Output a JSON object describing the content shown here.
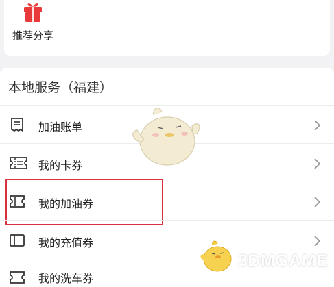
{
  "share": {
    "label": "推荐分享",
    "icon": "gift-icon",
    "icon_color": "#e83a3a"
  },
  "section": {
    "title": "本地服务（福建）"
  },
  "rows": [
    {
      "label": "加油账单",
      "icon": "receipt-icon"
    },
    {
      "label": "我的卡券",
      "icon": "ticket-icon"
    },
    {
      "label": "我的加油券",
      "icon": "coupon-icon"
    },
    {
      "label": "我的充值券",
      "icon": "card-icon"
    },
    {
      "label": "我的洗车券",
      "icon": "coupon-icon"
    }
  ],
  "watermark": {
    "text": "3DMGAME"
  },
  "colors": {
    "highlight": "#d9303e",
    "mascot": "#f3ecd2"
  }
}
